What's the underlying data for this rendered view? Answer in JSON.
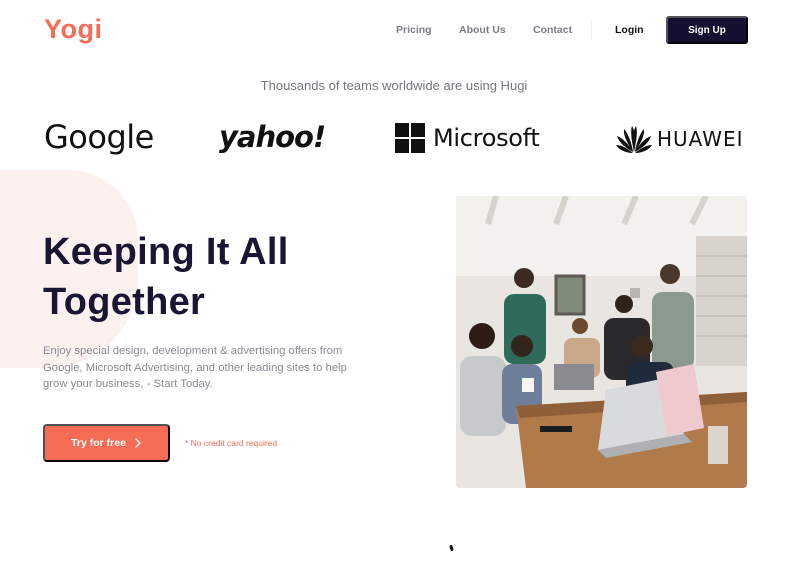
{
  "header": {
    "logo": "Yogi",
    "nav": [
      "Pricing",
      "About Us",
      "Contact"
    ],
    "login_label": "Login",
    "signup_label": "Sign Up"
  },
  "partners": {
    "tagline": "Thousands of teams worldwide are using Hugi",
    "logos": [
      "Google",
      "yahoo!",
      "Microsoft",
      "HUAWEI"
    ]
  },
  "hero": {
    "title_line1": "Keeping It All",
    "title_line2": "Together",
    "description": "Enjoy special design, development & advertising offers from Google, Microsoft Advertising, and other leading sites to help grow your business, - Start Today.",
    "cta_label": "Try for free",
    "cta_icon": "chevron-right-icon",
    "note": "* No credit card required",
    "image": "team-meeting-photo"
  },
  "colors": {
    "brand": "#f76c55",
    "dark": "#141031",
    "muted": "#7c7d85"
  }
}
